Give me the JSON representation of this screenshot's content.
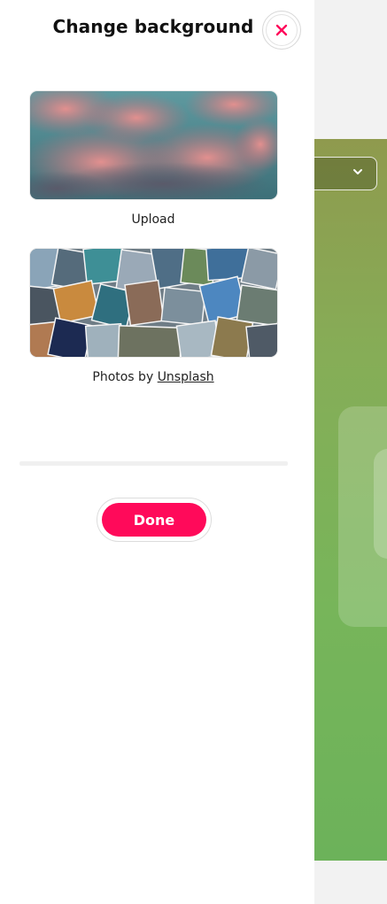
{
  "panel": {
    "title": "Change background",
    "close_icon": "close-icon",
    "upload": {
      "label": "Upload"
    },
    "photos": {
      "label_prefix": "Photos by ",
      "link_text": "Unsplash"
    },
    "done_label": "Done"
  },
  "colors": {
    "accent": "#ff0a5a",
    "background_green": "#77b55a"
  },
  "background_app": {
    "dropdown_icon": "chevron-down-icon"
  }
}
